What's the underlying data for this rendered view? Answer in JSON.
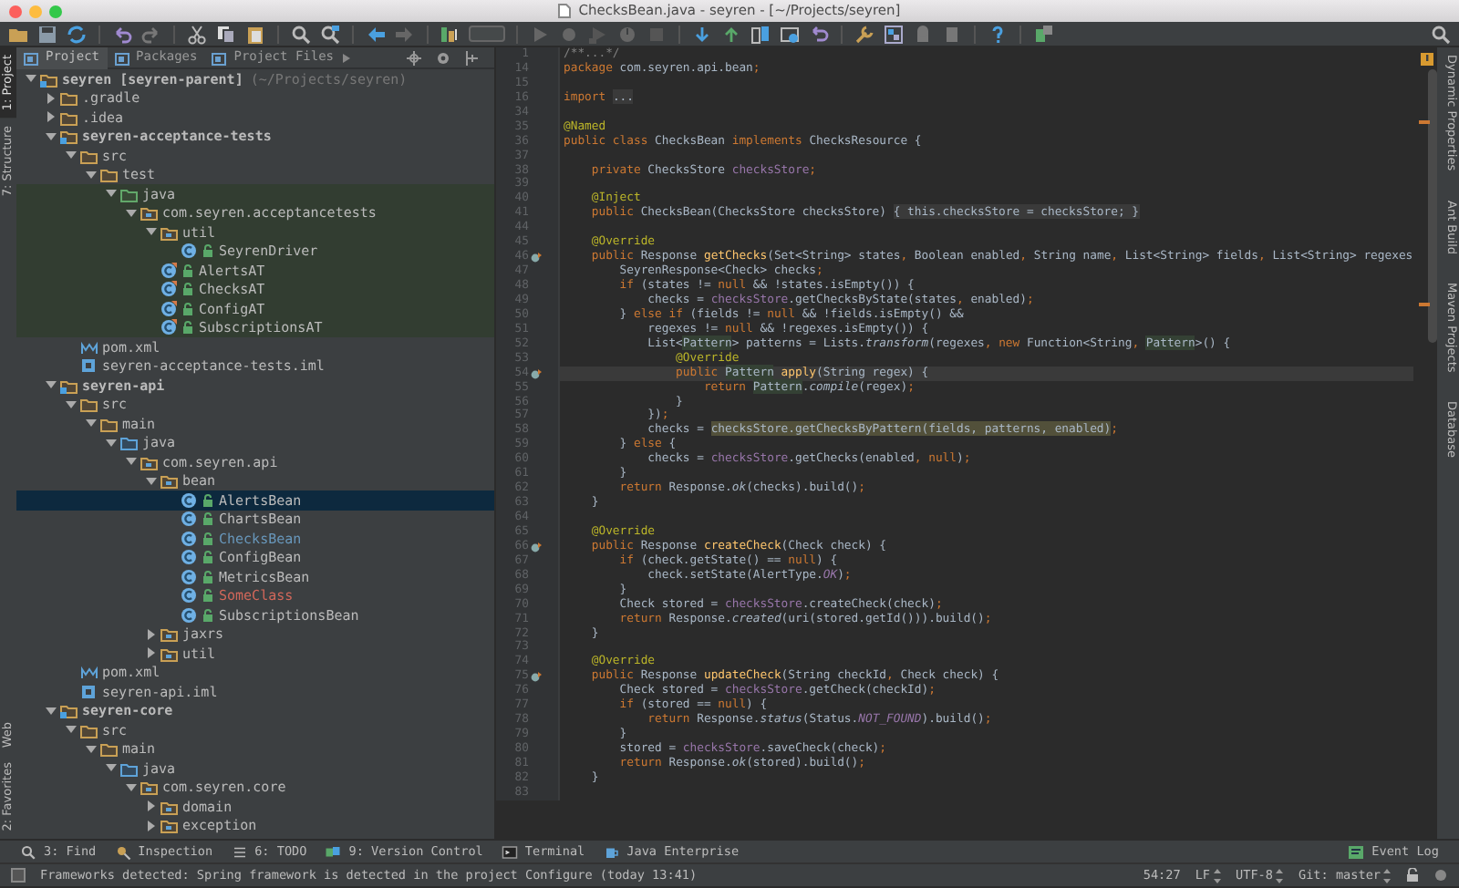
{
  "window": {
    "title": "ChecksBean.java - seyren - [~/Projects/seyren]"
  },
  "left_stripe": {
    "top": [
      {
        "label": "1: Project",
        "selected": true
      },
      {
        "label": "7: Structure",
        "selected": false
      }
    ],
    "bottom": [
      {
        "label": "Web",
        "selected": false
      },
      {
        "label": "2: Favorites",
        "selected": false
      }
    ]
  },
  "right_stripe": [
    {
      "label": "Dynamic Properties",
      "selected": false
    },
    {
      "label": "Ant Build",
      "selected": false
    },
    {
      "label": "Maven Projects",
      "selected": false
    },
    {
      "label": "Database",
      "selected": false
    }
  ],
  "project_tabs": [
    {
      "label": "Project",
      "selected": true
    },
    {
      "label": "Packages",
      "selected": false
    },
    {
      "label": "Project Files",
      "selected": false
    }
  ],
  "project_tree": [
    {
      "label": "seyren [seyren-parent]",
      "path": "(~/Projects/seyren)",
      "kind": "module",
      "expanded": true,
      "selected": false,
      "children": [
        {
          "label": ".gradle",
          "kind": "folder",
          "expanded": false,
          "selected": false
        },
        {
          "label": ".idea",
          "kind": "folder",
          "expanded": false,
          "selected": false
        },
        {
          "label": "seyren-acceptance-tests",
          "kind": "module",
          "expanded": true,
          "selected": false,
          "children": [
            {
              "label": "src",
              "kind": "folder",
              "expanded": true,
              "selected": false,
              "children": [
                {
                  "label": "test",
                  "kind": "folder",
                  "expanded": true,
                  "selected": false,
                  "children": [
                    {
                      "label": "java",
                      "kind": "test-source",
                      "test_root": true,
                      "expanded": true,
                      "selected": false,
                      "children": [
                        {
                          "label": "com.seyren.acceptancetests",
                          "kind": "package",
                          "expanded": true,
                          "selected": false,
                          "children": [
                            {
                              "label": "util",
                              "kind": "package",
                              "expanded": true,
                              "selected": false,
                              "children": [
                                {
                                  "label": "SeyrenDriver",
                                  "kind": "class",
                                  "selected": false
                                }
                              ]
                            },
                            {
                              "label": "AlertsAT",
                              "kind": "test-class",
                              "selected": false
                            },
                            {
                              "label": "ChecksAT",
                              "kind": "test-class",
                              "selected": false
                            },
                            {
                              "label": "ConfigAT",
                              "kind": "test-class",
                              "selected": false
                            },
                            {
                              "label": "SubscriptionsAT",
                              "kind": "test-class",
                              "selected": false
                            }
                          ]
                        }
                      ]
                    }
                  ]
                }
              ]
            },
            {
              "label": "pom.xml",
              "kind": "maven",
              "selected": false
            },
            {
              "label": "seyren-acceptance-tests.iml",
              "kind": "iml",
              "selected": false
            }
          ]
        },
        {
          "label": "seyren-api",
          "kind": "module",
          "expanded": true,
          "selected": false,
          "children": [
            {
              "label": "src",
              "kind": "folder",
              "expanded": true,
              "selected": false,
              "children": [
                {
                  "label": "main",
                  "kind": "folder",
                  "expanded": true,
                  "selected": false,
                  "children": [
                    {
                      "label": "java",
                      "kind": "source",
                      "expanded": true,
                      "selected": false,
                      "children": [
                        {
                          "label": "com.seyren.api",
                          "kind": "package",
                          "expanded": true,
                          "selected": false,
                          "children": [
                            {
                              "label": "bean",
                              "kind": "package",
                              "expanded": true,
                              "selected": false,
                              "children": [
                                {
                                  "label": "AlertsBean",
                                  "kind": "class",
                                  "modified": false,
                                  "unversioned": false,
                                  "selected": true
                                },
                                {
                                  "label": "ChartsBean",
                                  "kind": "class",
                                  "modified": false,
                                  "unversioned": false,
                                  "selected": false
                                },
                                {
                                  "label": "ChecksBean",
                                  "kind": "class",
                                  "modified": true,
                                  "unversioned": false,
                                  "selected": false
                                },
                                {
                                  "label": "ConfigBean",
                                  "kind": "class",
                                  "modified": false,
                                  "unversioned": false,
                                  "selected": false
                                },
                                {
                                  "label": "MetricsBean",
                                  "kind": "class",
                                  "modified": false,
                                  "unversioned": false,
                                  "selected": false
                                },
                                {
                                  "label": "SomeClass",
                                  "kind": "class",
                                  "modified": false,
                                  "unversioned": true,
                                  "selected": false
                                },
                                {
                                  "label": "SubscriptionsBean",
                                  "kind": "class",
                                  "modified": false,
                                  "unversioned": false,
                                  "selected": false
                                }
                              ]
                            },
                            {
                              "label": "jaxrs",
                              "kind": "package",
                              "expanded": false,
                              "selected": false
                            },
                            {
                              "label": "util",
                              "kind": "package",
                              "expanded": false,
                              "selected": false
                            }
                          ]
                        }
                      ]
                    }
                  ]
                }
              ]
            },
            {
              "label": "pom.xml",
              "kind": "maven",
              "selected": false
            },
            {
              "label": "seyren-api.iml",
              "kind": "iml",
              "selected": false
            }
          ]
        },
        {
          "label": "seyren-core",
          "kind": "module",
          "expanded": true,
          "selected": false,
          "children": [
            {
              "label": "src",
              "kind": "folder",
              "expanded": true,
              "selected": false,
              "children": [
                {
                  "label": "main",
                  "kind": "folder",
                  "expanded": true,
                  "selected": false,
                  "children": [
                    {
                      "label": "java",
                      "kind": "source",
                      "expanded": true,
                      "selected": false,
                      "children": [
                        {
                          "label": "com.seyren.core",
                          "kind": "package",
                          "expanded": true,
                          "selected": false,
                          "children": [
                            {
                              "label": "domain",
                              "kind": "package",
                              "expanded": false,
                              "selected": false
                            },
                            {
                              "label": "exception",
                              "kind": "package",
                              "expanded": false,
                              "selected": false
                            }
                          ]
                        }
                      ]
                    }
                  ]
                }
              ]
            }
          ]
        }
      ]
    }
  ],
  "editor": {
    "lines": [
      {
        "number": "1",
        "code": [
          {
            "t": "/**...*/",
            "kind": "cm"
          }
        ]
      },
      {
        "number": "14",
        "code": [
          {
            "t": "package ",
            "kind": "kw"
          },
          {
            "t": "com.seyren.api.bean",
            "kind": "pl"
          },
          {
            "t": ";",
            "kind": "kw"
          }
        ]
      },
      {
        "number": "15"
      },
      {
        "number": "16",
        "code": [
          {
            "t": "import ",
            "kind": "kw"
          },
          {
            "t": "...",
            "kind": "fold"
          }
        ]
      },
      {
        "number": "34"
      },
      {
        "number": "35",
        "code": [
          {
            "t": "@Named",
            "kind": "ann"
          }
        ]
      },
      {
        "number": "36",
        "code": [
          {
            "t": "public class ",
            "kind": "kw"
          },
          {
            "t": "ChecksBean",
            "kind": "dim"
          },
          {
            "t": " implements ",
            "kind": "kw"
          },
          {
            "t": "ChecksResource {",
            "kind": "pl"
          }
        ]
      },
      {
        "number": "37"
      },
      {
        "number": "38",
        "code": [
          {
            "t": "    private ",
            "kind": "kw"
          },
          {
            "t": "ChecksStore ",
            "kind": "pl"
          },
          {
            "t": "checksStore",
            "kind": "fld"
          },
          {
            "t": ";",
            "kind": "kw"
          }
        ]
      },
      {
        "number": "39"
      },
      {
        "number": "40",
        "code": [
          {
            "t": "    @Inject",
            "kind": "ann"
          }
        ]
      },
      {
        "number": "41",
        "code": [
          {
            "t": "    public ",
            "kind": "kw"
          },
          {
            "t": "ChecksBean(ChecksStore checksStore) ",
            "kind": "pl"
          },
          {
            "t": "{ this.checksStore = checksStore; }",
            "kind": "fold"
          }
        ]
      },
      {
        "number": "44"
      },
      {
        "number": "45",
        "code": [
          {
            "t": "    @Override",
            "kind": "ann"
          }
        ]
      },
      {
        "number": "46",
        "marker": true,
        "code": [
          {
            "t": "    public ",
            "kind": "kw"
          },
          {
            "t": "Response ",
            "kind": "pl"
          },
          {
            "t": "getChecks",
            "kind": "mth"
          },
          {
            "t": "(Set<String> states",
            "kind": "pl"
          },
          {
            "t": ", ",
            "kind": "kw"
          },
          {
            "t": "Boolean enabled",
            "kind": "pl"
          },
          {
            "t": ", ",
            "kind": "kw"
          },
          {
            "t": "String name",
            "kind": "pl"
          },
          {
            "t": ", ",
            "kind": "kw"
          },
          {
            "t": "List<String> fields",
            "kind": "pl"
          },
          {
            "t": ", ",
            "kind": "kw"
          },
          {
            "t": "List<String> regexes",
            "kind": "pl"
          }
        ]
      },
      {
        "number": "47",
        "code": [
          {
            "t": "        SeyrenResponse",
            "kind": "dim"
          },
          {
            "t": "<Check> checks",
            "kind": "pl"
          },
          {
            "t": ";",
            "kind": "kw"
          }
        ]
      },
      {
        "number": "48",
        "code": [
          {
            "t": "        if ",
            "kind": "kw"
          },
          {
            "t": "(states != ",
            "kind": "pl"
          },
          {
            "t": "null ",
            "kind": "kw"
          },
          {
            "t": "&& !states.isEmpty()) {",
            "kind": "pl"
          }
        ]
      },
      {
        "number": "49",
        "code": [
          {
            "t": "            checks = ",
            "kind": "pl"
          },
          {
            "t": "checksStore",
            "kind": "fld"
          },
          {
            "t": ".getChecksByState(states",
            "kind": "pl"
          },
          {
            "t": ", ",
            "kind": "kw"
          },
          {
            "t": "enabled)",
            "kind": "pl"
          },
          {
            "t": ";",
            "kind": "kw"
          }
        ]
      },
      {
        "number": "50",
        "code": [
          {
            "t": "        } ",
            "kind": "pl"
          },
          {
            "t": "else if ",
            "kind": "kw"
          },
          {
            "t": "(fields != ",
            "kind": "pl"
          },
          {
            "t": "null ",
            "kind": "kw"
          },
          {
            "t": "&& !fields.isEmpty() &&",
            "kind": "pl"
          }
        ]
      },
      {
        "number": "51",
        "code": [
          {
            "t": "            regexes != ",
            "kind": "pl"
          },
          {
            "t": "null ",
            "kind": "kw"
          },
          {
            "t": "&& !regexes.isEmpty()) {",
            "kind": "pl"
          }
        ]
      },
      {
        "number": "52",
        "code": [
          {
            "t": "            List<",
            "kind": "pl"
          },
          {
            "t": "Pattern",
            "kind": "usage"
          },
          {
            "t": "> patterns = Lists.",
            "kind": "pl"
          },
          {
            "t": "transform",
            "kind": "it"
          },
          {
            "t": "(regexes",
            "kind": "pl"
          },
          {
            "t": ", new ",
            "kind": "kw"
          },
          {
            "t": "Function<String",
            "kind": "pl"
          },
          {
            "t": ", ",
            "kind": "kw"
          },
          {
            "t": "Pattern",
            "kind": "usage"
          },
          {
            "t": ">() {",
            "kind": "pl"
          }
        ]
      },
      {
        "number": "53",
        "code": [
          {
            "t": "                @Override",
            "kind": "ann"
          }
        ]
      },
      {
        "number": "54",
        "marker": true,
        "current": true,
        "code": [
          {
            "t": "                public ",
            "kind": "kw"
          },
          {
            "t": "Pattern",
            "kind": "usage"
          },
          {
            "t": " apply",
            "kind": "mth"
          },
          {
            "t": "(String regex) {",
            "kind": "pl"
          }
        ]
      },
      {
        "number": "55",
        "code": [
          {
            "t": "                    return ",
            "kind": "kw"
          },
          {
            "t": "Pattern",
            "kind": "usage"
          },
          {
            "t": ".",
            "kind": "pl"
          },
          {
            "t": "compile",
            "kind": "it"
          },
          {
            "t": "(regex)",
            "kind": "pl"
          },
          {
            "t": ";",
            "kind": "kw"
          }
        ]
      },
      {
        "number": "56",
        "code": [
          {
            "t": "                }",
            "kind": "pl"
          }
        ]
      },
      {
        "number": "57",
        "code": [
          {
            "t": "            })",
            "kind": "pl"
          },
          {
            "t": ";",
            "kind": "kw"
          }
        ]
      },
      {
        "number": "58",
        "code": [
          {
            "t": "            checks = ",
            "kind": "pl"
          },
          {
            "t": "checksStore.getChecksByPattern(fields, patterns, enabled)",
            "kind": "found"
          },
          {
            "t": ";",
            "kind": "kw"
          }
        ]
      },
      {
        "number": "59",
        "code": [
          {
            "t": "        } ",
            "kind": "pl"
          },
          {
            "t": "else ",
            "kind": "kw"
          },
          {
            "t": "{",
            "kind": "pl"
          }
        ]
      },
      {
        "number": "60",
        "code": [
          {
            "t": "            checks = ",
            "kind": "pl"
          },
          {
            "t": "checksStore",
            "kind": "fld"
          },
          {
            "t": ".getChecks(enabled",
            "kind": "pl"
          },
          {
            "t": ", null",
            "kind": "kw"
          },
          {
            "t": ")",
            "kind": "pl"
          },
          {
            "t": ";",
            "kind": "kw"
          }
        ]
      },
      {
        "number": "61",
        "code": [
          {
            "t": "        }",
            "kind": "pl"
          }
        ]
      },
      {
        "number": "62",
        "code": [
          {
            "t": "        return ",
            "kind": "kw"
          },
          {
            "t": "Response.",
            "kind": "pl"
          },
          {
            "t": "ok",
            "kind": "it"
          },
          {
            "t": "(checks).build()",
            "kind": "pl"
          },
          {
            "t": ";",
            "kind": "kw"
          }
        ]
      },
      {
        "number": "63",
        "code": [
          {
            "t": "    }",
            "kind": "pl"
          }
        ]
      },
      {
        "number": "64"
      },
      {
        "number": "65",
        "code": [
          {
            "t": "    @Override",
            "kind": "ann"
          }
        ]
      },
      {
        "number": "66",
        "marker": true,
        "code": [
          {
            "t": "    public ",
            "kind": "kw"
          },
          {
            "t": "Response ",
            "kind": "pl"
          },
          {
            "t": "createCheck",
            "kind": "mth"
          },
          {
            "t": "(Check check) {",
            "kind": "pl"
          }
        ]
      },
      {
        "number": "67",
        "code": [
          {
            "t": "        if ",
            "kind": "kw"
          },
          {
            "t": "(check.getState() == ",
            "kind": "pl"
          },
          {
            "t": "null",
            "kind": "kw"
          },
          {
            "t": ") {",
            "kind": "pl"
          }
        ]
      },
      {
        "number": "68",
        "code": [
          {
            "t": "            check.setState(AlertType.",
            "kind": "pl"
          },
          {
            "t": "OK",
            "kind": "cnst"
          },
          {
            "t": ")",
            "kind": "pl"
          },
          {
            "t": ";",
            "kind": "kw"
          }
        ]
      },
      {
        "number": "69",
        "code": [
          {
            "t": "        }",
            "kind": "pl"
          }
        ]
      },
      {
        "number": "70",
        "code": [
          {
            "t": "        Check stored = ",
            "kind": "pl"
          },
          {
            "t": "checksStore",
            "kind": "fld"
          },
          {
            "t": ".createCheck(check)",
            "kind": "pl"
          },
          {
            "t": ";",
            "kind": "kw"
          }
        ]
      },
      {
        "number": "71",
        "code": [
          {
            "t": "        return ",
            "kind": "kw"
          },
          {
            "t": "Response.",
            "kind": "pl"
          },
          {
            "t": "created",
            "kind": "it"
          },
          {
            "t": "(uri(stored.getId())).build()",
            "kind": "pl"
          },
          {
            "t": ";",
            "kind": "kw"
          }
        ]
      },
      {
        "number": "72",
        "code": [
          {
            "t": "    }",
            "kind": "pl"
          }
        ]
      },
      {
        "number": "73"
      },
      {
        "number": "74",
        "code": [
          {
            "t": "    @Override",
            "kind": "ann"
          }
        ]
      },
      {
        "number": "75",
        "marker": true,
        "code": [
          {
            "t": "    public ",
            "kind": "kw"
          },
          {
            "t": "Response ",
            "kind": "pl"
          },
          {
            "t": "updateCheck",
            "kind": "mth"
          },
          {
            "t": "(String checkId",
            "kind": "pl"
          },
          {
            "t": ", ",
            "kind": "kw"
          },
          {
            "t": "Check check) {",
            "kind": "pl"
          }
        ]
      },
      {
        "number": "76",
        "code": [
          {
            "t": "        Check stored = ",
            "kind": "pl"
          },
          {
            "t": "checksStore",
            "kind": "fld"
          },
          {
            "t": ".getCheck(checkId)",
            "kind": "pl"
          },
          {
            "t": ";",
            "kind": "kw"
          }
        ]
      },
      {
        "number": "77",
        "code": [
          {
            "t": "        if ",
            "kind": "kw"
          },
          {
            "t": "(stored == ",
            "kind": "pl"
          },
          {
            "t": "null",
            "kind": "kw"
          },
          {
            "t": ") {",
            "kind": "pl"
          }
        ]
      },
      {
        "number": "78",
        "code": [
          {
            "t": "            return ",
            "kind": "kw"
          },
          {
            "t": "Response.",
            "kind": "pl"
          },
          {
            "t": "status",
            "kind": "it"
          },
          {
            "t": "(Status.",
            "kind": "pl"
          },
          {
            "t": "NOT_FOUND",
            "kind": "cnst"
          },
          {
            "t": ").build()",
            "kind": "pl"
          },
          {
            "t": ";",
            "kind": "kw"
          }
        ]
      },
      {
        "number": "79",
        "code": [
          {
            "t": "        }",
            "kind": "pl"
          }
        ]
      },
      {
        "number": "80",
        "code": [
          {
            "t": "        stored = ",
            "kind": "pl"
          },
          {
            "t": "checksStore",
            "kind": "fld"
          },
          {
            "t": ".saveCheck(check)",
            "kind": "pl"
          },
          {
            "t": ";",
            "kind": "kw"
          }
        ]
      },
      {
        "number": "81",
        "code": [
          {
            "t": "        return ",
            "kind": "kw"
          },
          {
            "t": "Response.",
            "kind": "pl"
          },
          {
            "t": "ok",
            "kind": "it"
          },
          {
            "t": "(stored).build()",
            "kind": "pl"
          },
          {
            "t": ";",
            "kind": "kw"
          }
        ]
      },
      {
        "number": "82",
        "code": [
          {
            "t": "    }",
            "kind": "pl"
          }
        ]
      },
      {
        "number": "83"
      }
    ]
  },
  "tool_windows": {
    "left": [
      "3: Find",
      "Inspection",
      "6: TODO",
      "9: Version Control",
      "Terminal",
      "Java Enterprise"
    ],
    "right": [
      "Event Log"
    ]
  },
  "status_bar": {
    "message": "Frameworks detected: Spring framework is detected in the project Configure (today 13:41)",
    "position": "54:27",
    "line_separator": "LF",
    "encoding": "UTF-8",
    "vcs_branch": "Git: master"
  }
}
